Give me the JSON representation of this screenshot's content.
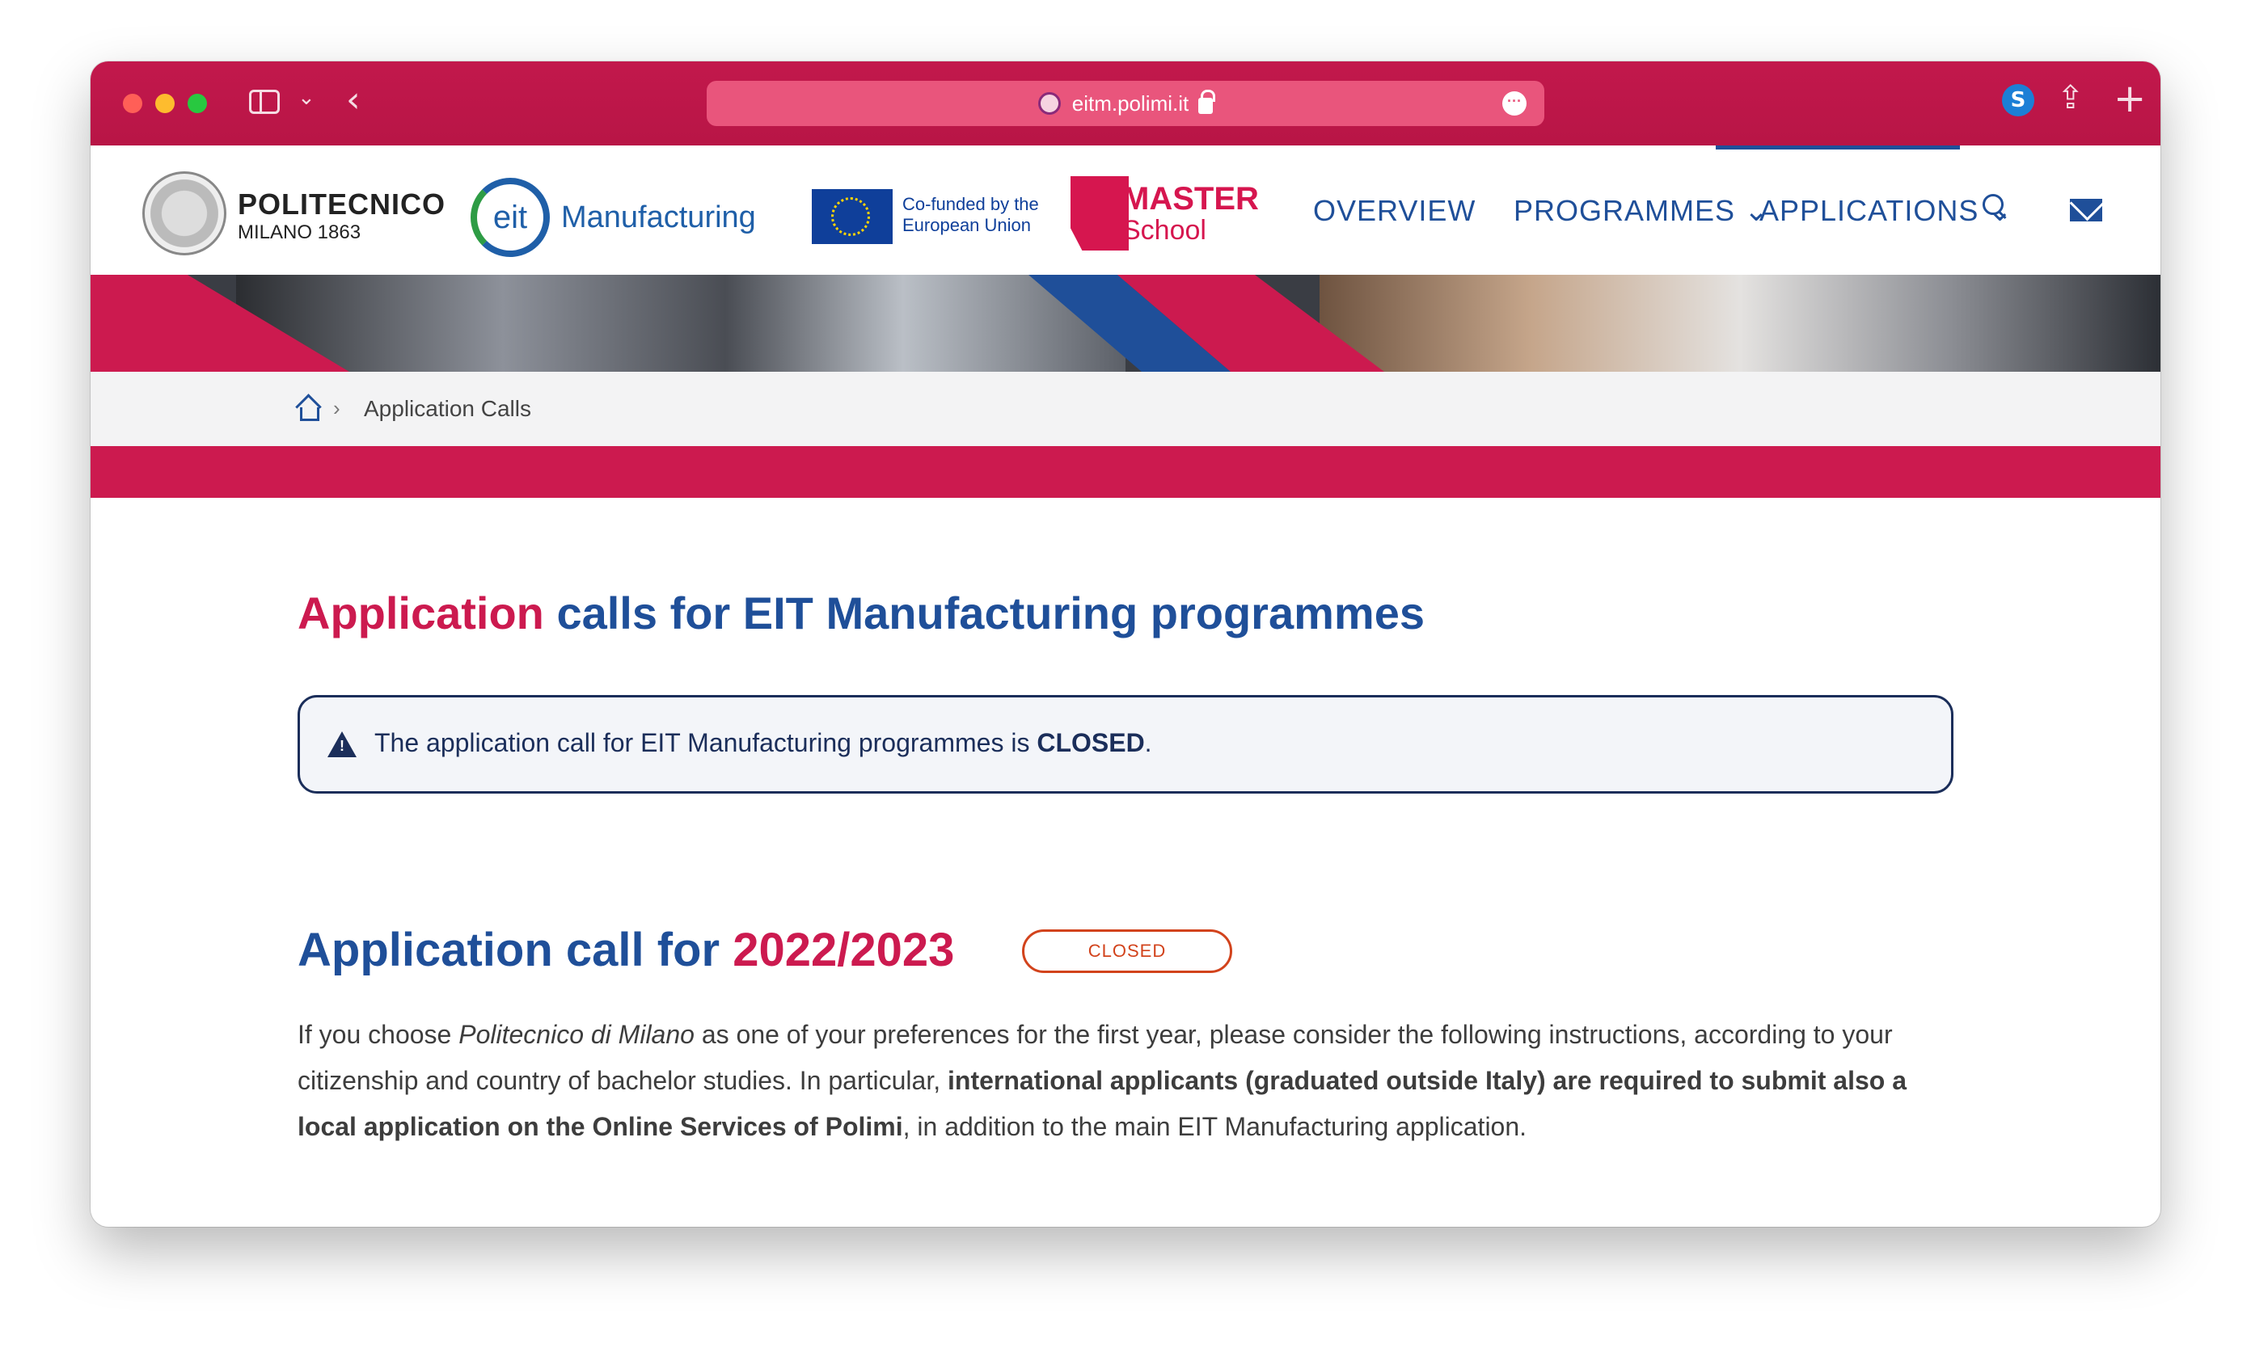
{
  "browser": {
    "url": "eitm.polimi.it"
  },
  "logos": {
    "polimi_name": "POLITECNICO",
    "polimi_sub": "MILANO 1863",
    "eit_mark": "eit",
    "eit_manufacturing": "Manufacturing",
    "eu_line1": "Co-funded by the",
    "eu_line2": "European Union",
    "master_top": "MASTER",
    "master_bottom": "School"
  },
  "nav": {
    "overview": "OVERVIEW",
    "programmes": "PROGRAMMES",
    "applications": "APPLICATIONS",
    "dropdown_glyph": "⌄"
  },
  "breadcrumb": {
    "separator": "›",
    "current": "Application Calls"
  },
  "main": {
    "title_accent": "Application",
    "title_rest": "calls for EIT Manufacturing programmes",
    "notice_prefix": "The application call for EIT Manufacturing programmes is",
    "notice_status": "CLOSED",
    "notice_suffix": ".",
    "section_title_prefix": "Application call for",
    "section_year": "2022/2023",
    "status_badge": "CLOSED",
    "body": {
      "p1": "If you choose",
      "p2": "Politecnico di Milano",
      "p3": "as one of your preferences for the first year, please consider the following instructions, according to your citizenship and country of bachelor studies. In particular,",
      "p4": "international applicants (graduated outside Italy) are required to submit also a local application on the Online Services of Polimi",
      "p5": ", in addition to the main EIT Manufacturing application."
    }
  },
  "colors": {
    "brand_red": "#cc1a4f",
    "brand_blue": "#1f4f99",
    "closed_orange": "#d2431c"
  }
}
